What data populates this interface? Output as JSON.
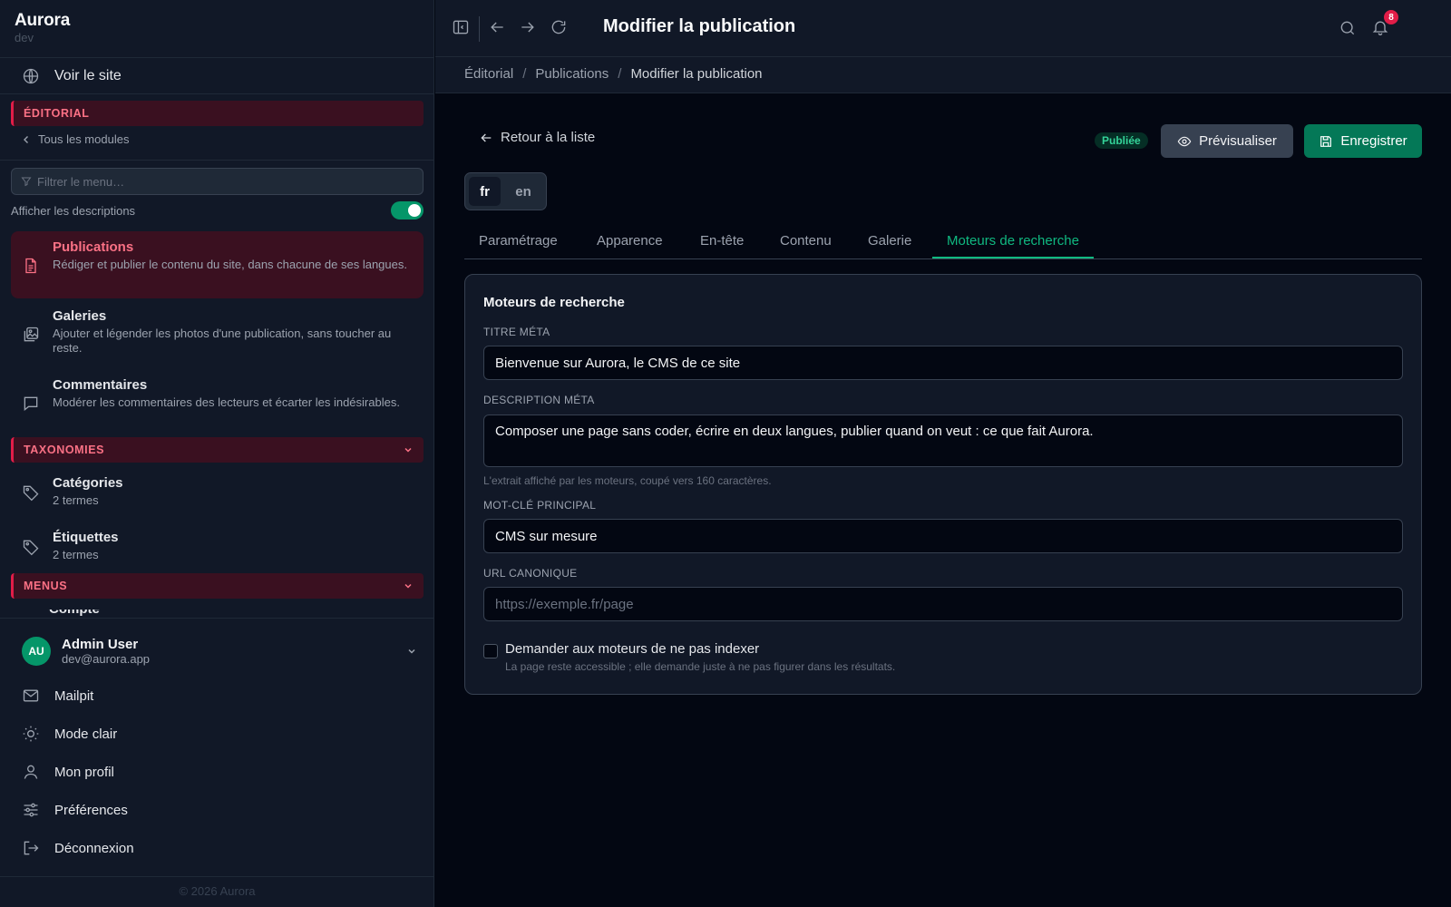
{
  "brand": {
    "name": "Aurora",
    "env": "dev"
  },
  "sidebar": {
    "view_site": "Voir le site",
    "editorial_header": "ÉDITORIAL",
    "back_modules": "Tous les modules",
    "filter_placeholder": "Filtrer le menu…",
    "show_descriptions": "Afficher les descriptions",
    "show_descriptions_on": true,
    "editorial_items": [
      {
        "title": "Publications",
        "desc": "Rédiger et publier le contenu du site, dans chacune de ses langues.",
        "icon": "document-icon",
        "active": true
      },
      {
        "title": "Galeries",
        "desc": "Ajouter et légender les photos d'une publication, sans toucher au reste.",
        "icon": "gallery-icon"
      },
      {
        "title": "Commentaires",
        "desc": "Modérer les commentaires des lecteurs et écarter les indésirables.",
        "icon": "comment-icon"
      }
    ],
    "taxonomies_header": "TAXONOMIES",
    "taxonomy_items": [
      {
        "title": "Catégories",
        "desc": "2 termes",
        "icon": "tag-icon"
      },
      {
        "title": "Étiquettes",
        "desc": "2 termes",
        "icon": "tag-icon"
      }
    ],
    "menus_header": "MENUS",
    "menus_cut_item": "Compte",
    "user": {
      "initials": "AU",
      "name": "Admin User",
      "email": "dev@aurora.app"
    },
    "bottom_links": [
      "Mailpit",
      "Mode clair",
      "Mon profil",
      "Préférences",
      "Déconnexion"
    ],
    "copyright": "© 2026 Aurora"
  },
  "header": {
    "title": "Modifier la publication",
    "notifications_count": "8",
    "breadcrumb": [
      "Éditorial",
      "Publications",
      "Modifier la publication"
    ]
  },
  "main": {
    "back_label": "Retour à la liste",
    "status": "Publiée",
    "preview_label": "Prévisualiser",
    "save_label": "Enregistrer",
    "languages": [
      "fr",
      "en"
    ],
    "active_language": "fr",
    "tabs": [
      "Paramétrage",
      "Apparence",
      "En-tête",
      "Contenu",
      "Galerie",
      "Moteurs de recherche"
    ],
    "active_tab": "Moteurs de recherche",
    "card": {
      "title": "Moteurs de recherche",
      "meta_title_label": "TITRE MÉTA",
      "meta_title_value": "Bienvenue sur Aurora, le CMS de ce site",
      "meta_desc_label": "DESCRIPTION MÉTA",
      "meta_desc_value": "Composer une page sans coder, écrire en deux langues, publier quand on veut : ce que fait Aurora.",
      "meta_desc_help": "L'extrait affiché par les moteurs, coupé vers 160 caractères.",
      "keyword_label": "MOT-CLÉ PRINCIPAL",
      "keyword_value": "CMS sur mesure",
      "canonical_label": "URL CANONIQUE",
      "canonical_placeholder": "https://exemple.fr/page",
      "noindex_label": "Demander aux moteurs de ne pas indexer",
      "noindex_help": "La page reste accessible ; elle demande juste à ne pas figurer dans les résultats.",
      "noindex_checked": false
    }
  },
  "colors": {
    "accent": "#10b981",
    "danger": "#e11d48",
    "bg": "#030712",
    "panel": "#111827"
  }
}
